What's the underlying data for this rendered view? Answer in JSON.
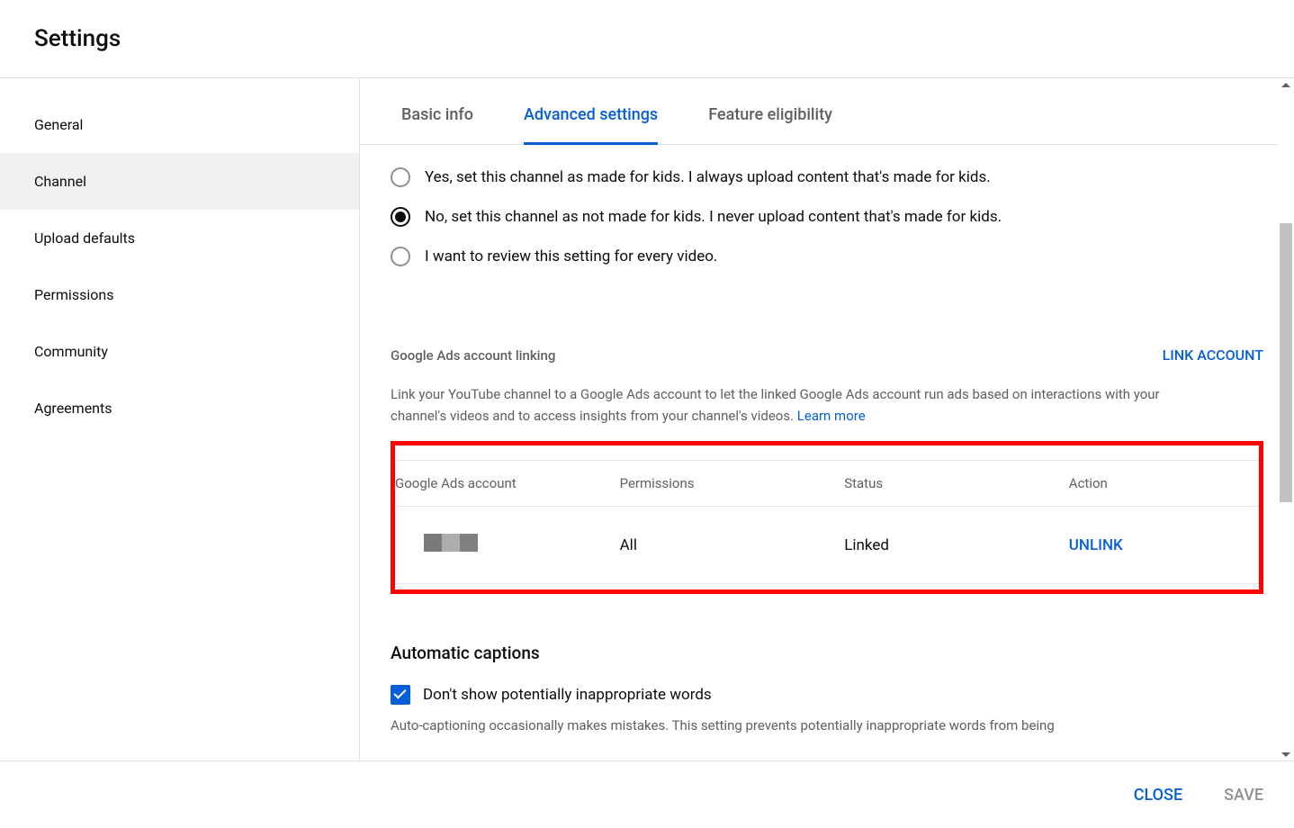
{
  "header": {
    "title": "Settings"
  },
  "sidebar": {
    "items": [
      {
        "label": "General",
        "active": false
      },
      {
        "label": "Channel",
        "active": true
      },
      {
        "label": "Upload defaults",
        "active": false
      },
      {
        "label": "Permissions",
        "active": false
      },
      {
        "label": "Community",
        "active": false
      },
      {
        "label": "Agreements",
        "active": false
      }
    ]
  },
  "tabs": [
    {
      "label": "Basic info",
      "active": false
    },
    {
      "label": "Advanced settings",
      "active": true
    },
    {
      "label": "Feature eligibility",
      "active": false
    }
  ],
  "kids_radio": {
    "options": [
      {
        "label": "Yes, set this channel as made for kids. I always upload content that's made for kids.",
        "checked": false
      },
      {
        "label": "No, set this channel as not made for kids. I never upload content that's made for kids.",
        "checked": true
      },
      {
        "label": "I want to review this setting for every video.",
        "checked": false
      }
    ]
  },
  "ads": {
    "title": "Google Ads account linking",
    "link_button": "LINK ACCOUNT",
    "description": "Link your YouTube channel to a Google Ads account to let the linked Google Ads account run ads based on interactions with your channel's videos and to access insights from your channel's videos. ",
    "learn_more": "Learn more",
    "columns": {
      "account": "Google Ads account",
      "permissions": "Permissions",
      "status": "Status",
      "action": "Action"
    },
    "row": {
      "permissions": "All",
      "status": "Linked",
      "action": "UNLINK"
    }
  },
  "captions": {
    "title": "Automatic captions",
    "checkbox_label": "Don't show potentially inappropriate words",
    "description": "Auto-captioning occasionally makes mistakes. This setting prevents potentially inappropriate words from being"
  },
  "footer": {
    "close": "CLOSE",
    "save": "SAVE"
  }
}
